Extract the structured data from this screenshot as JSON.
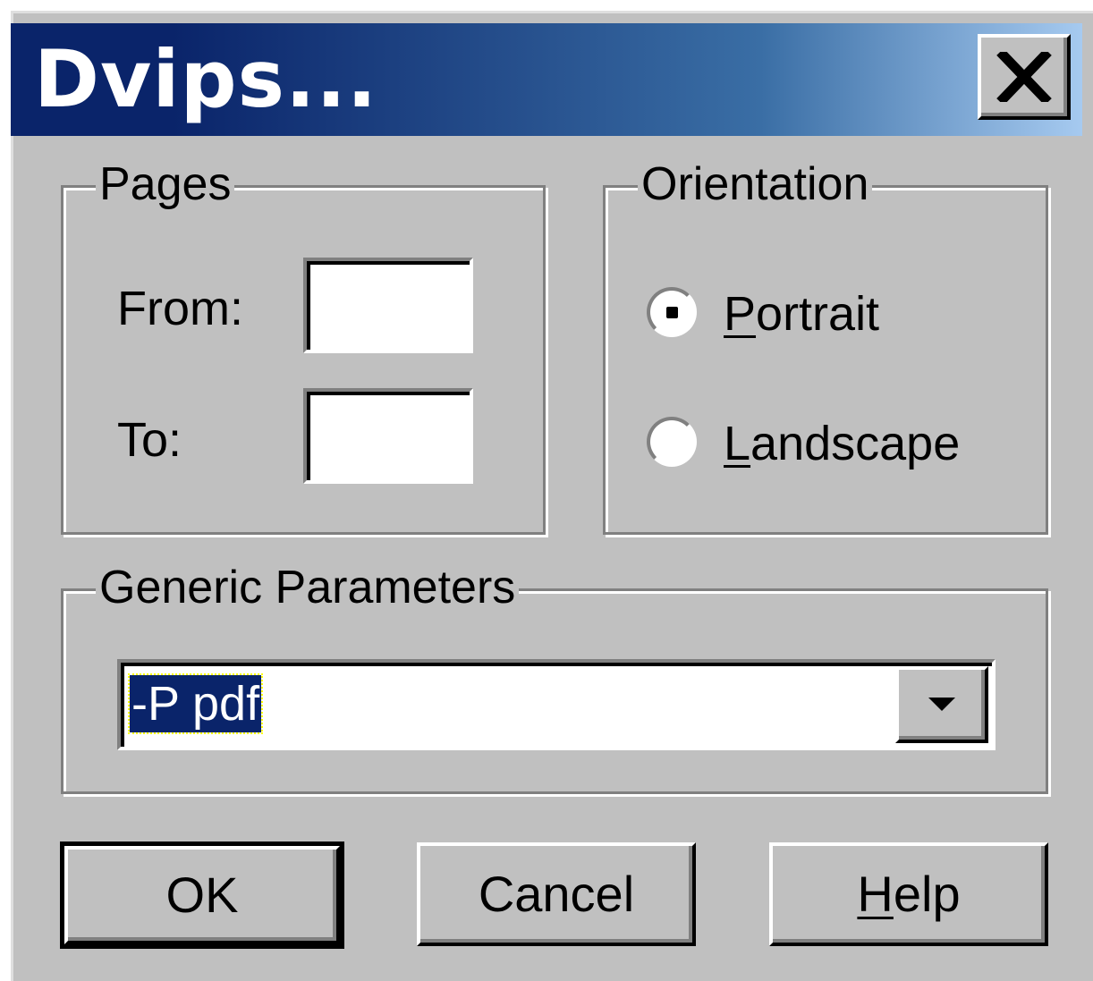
{
  "window": {
    "title": "Dvips..."
  },
  "titlebar": {
    "close_icon": "close-icon"
  },
  "pages": {
    "legend": "Pages",
    "from_label": "From:",
    "to_label": "To:",
    "from_value": "",
    "to_value": ""
  },
  "orientation": {
    "legend": "Orientation",
    "portrait_label_mnemonic": "P",
    "portrait_label_rest": "ortrait",
    "landscape_label_mnemonic": "L",
    "landscape_label_rest": "andscape",
    "selected": "Portrait"
  },
  "generic": {
    "legend": "Generic Parameters",
    "value": "-P pdf",
    "dropdown_icon": "chevron-down-icon"
  },
  "buttons": {
    "ok": "OK",
    "cancel": "Cancel",
    "help_mnemonic": "H",
    "help_rest": "elp"
  },
  "colors": {
    "titlebar_start": "#0a246a",
    "titlebar_end": "#a6caf0",
    "face": "#c0c0c0",
    "selection": "#0a246a"
  }
}
